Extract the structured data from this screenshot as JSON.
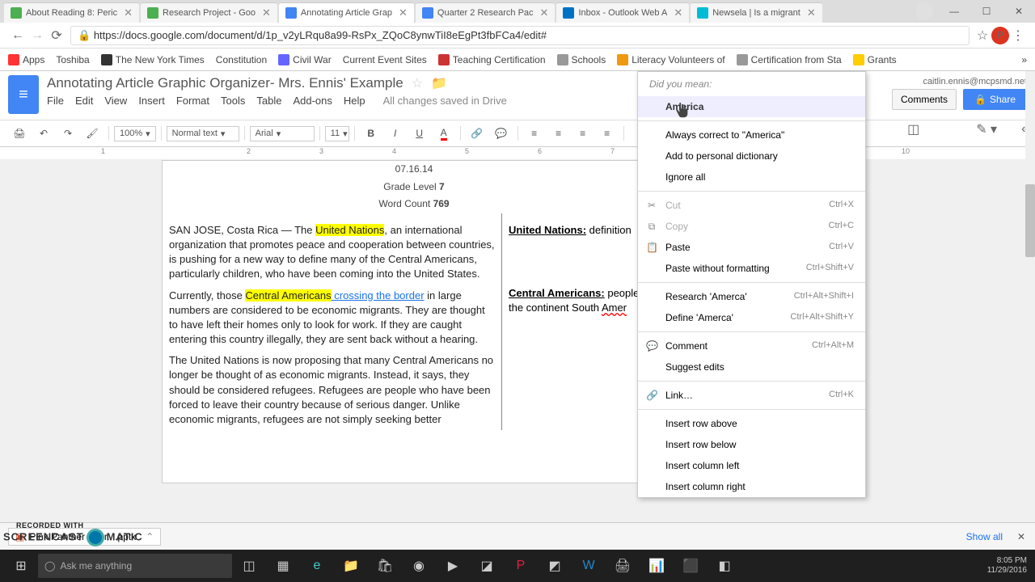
{
  "browser": {
    "tabs": [
      {
        "label": "About Reading 8: Peric",
        "favcolor": "#4caf50"
      },
      {
        "label": "Research Project - Goo",
        "favcolor": "#4caf50"
      },
      {
        "label": "Annotating Article Grap",
        "favcolor": "#4285f4",
        "active": true
      },
      {
        "label": "Quarter 2 Research Pac",
        "favcolor": "#4285f4"
      },
      {
        "label": "Inbox - Outlook Web A",
        "favcolor": "#0072c6"
      },
      {
        "label": "Newsela | Is a migrant",
        "favcolor": "#00bcd4"
      }
    ],
    "url": "https://docs.google.com/document/d/1p_v2yLRqu8a99-RsPx_ZQoC8ynwTiI8eEgPt3fbFCa4/edit#",
    "bookmarks": [
      "Apps",
      "Toshiba",
      "The New York Times",
      "Constitution",
      "Civil War",
      "Current Event Sites",
      "Teaching Certification",
      "Schools",
      "Literacy Volunteers of",
      "Certification from Sta",
      "Grants"
    ]
  },
  "docs": {
    "title": "Annotating Article Graphic Organizer- Mrs. Ennis' Example",
    "menus": [
      "File",
      "Edit",
      "View",
      "Insert",
      "Format",
      "Tools",
      "Table",
      "Add-ons",
      "Help"
    ],
    "saved": "All changes saved in Drive",
    "user": "caitlin.ennis@mcpsmd.net",
    "comments": "Comments",
    "share": "Share",
    "toolbar": {
      "zoom": "100%",
      "style": "Normal text",
      "font": "Arial",
      "size": "11"
    }
  },
  "ruler": [
    "1",
    "2",
    "3",
    "4",
    "5",
    "6",
    "7",
    "10"
  ],
  "content": {
    "date": "07.16.14",
    "grade_label": "Grade Level",
    "grade": "7",
    "wc_label": "Word Count",
    "wc": "769",
    "p1a": "SAN JOSE, Costa Rica — The ",
    "p1_hl": "United Nations",
    "p1b": ", an international organization that promotes peace and cooperation between countries, is pushing for a new way to define many of the Central Americans, particularly children, who have been coming into the United States.",
    "p2a": "Currently, those ",
    "p2_hl": "Central Americans",
    "p2_link": " crossing the border",
    "p2b": " in large numbers are considered to be economic migrants. They are thought to have left their homes only to look for work. If they are caught entering this country illegally, they are sent back without a hearing.",
    "p3": "The United Nations is now proposing that many Central Americans no longer be thought of as economic migrants. Instead, it says, they should be considered refugees. Refugees are people who have been forced to leave their country because of serious danger. Unlike economic migrants, refugees are not simply seeking better",
    "note1_key": "United Nations:",
    "note1_val": " definition",
    "note2_key": "Central Americans:",
    "note2_val": " people of the continent South ",
    "note2_err": "Amer"
  },
  "ctx": {
    "did_you_mean": "Did you mean:",
    "suggestion": "America",
    "always": "Always correct to \"America\"",
    "add_dict": "Add to personal dictionary",
    "ignore": "Ignore all",
    "cut": "Cut",
    "copy": "Copy",
    "paste": "Paste",
    "paste_nf": "Paste without formatting",
    "research": "Research 'Amerca'",
    "define": "Define 'Amerca'",
    "comment": "Comment",
    "suggest": "Suggest edits",
    "link": "Link…",
    "row_above": "Insert row above",
    "row_below": "Insert row below",
    "col_left": "Insert column left",
    "col_right": "Insert column right",
    "sc": {
      "cut": "Ctrl+X",
      "copy": "Ctrl+C",
      "paste": "Ctrl+V",
      "paste_nf": "Ctrl+Shift+V",
      "research": "Ctrl+Alt+Shift+I",
      "define": "Ctrl+Alt+Shift+Y",
      "comment": "Ctrl+Alt+M",
      "link": "Ctrl+K"
    }
  },
  "download": {
    "file": "Pink Panther Thur....pptx",
    "showall": "Show all"
  },
  "recorded": "RECORDED WITH",
  "watermark_a": "SCREENCAST",
  "watermark_b": "MATIC",
  "taskbar": {
    "search": "Ask me anything",
    "time": "8:05 PM",
    "date": "11/29/2016"
  }
}
